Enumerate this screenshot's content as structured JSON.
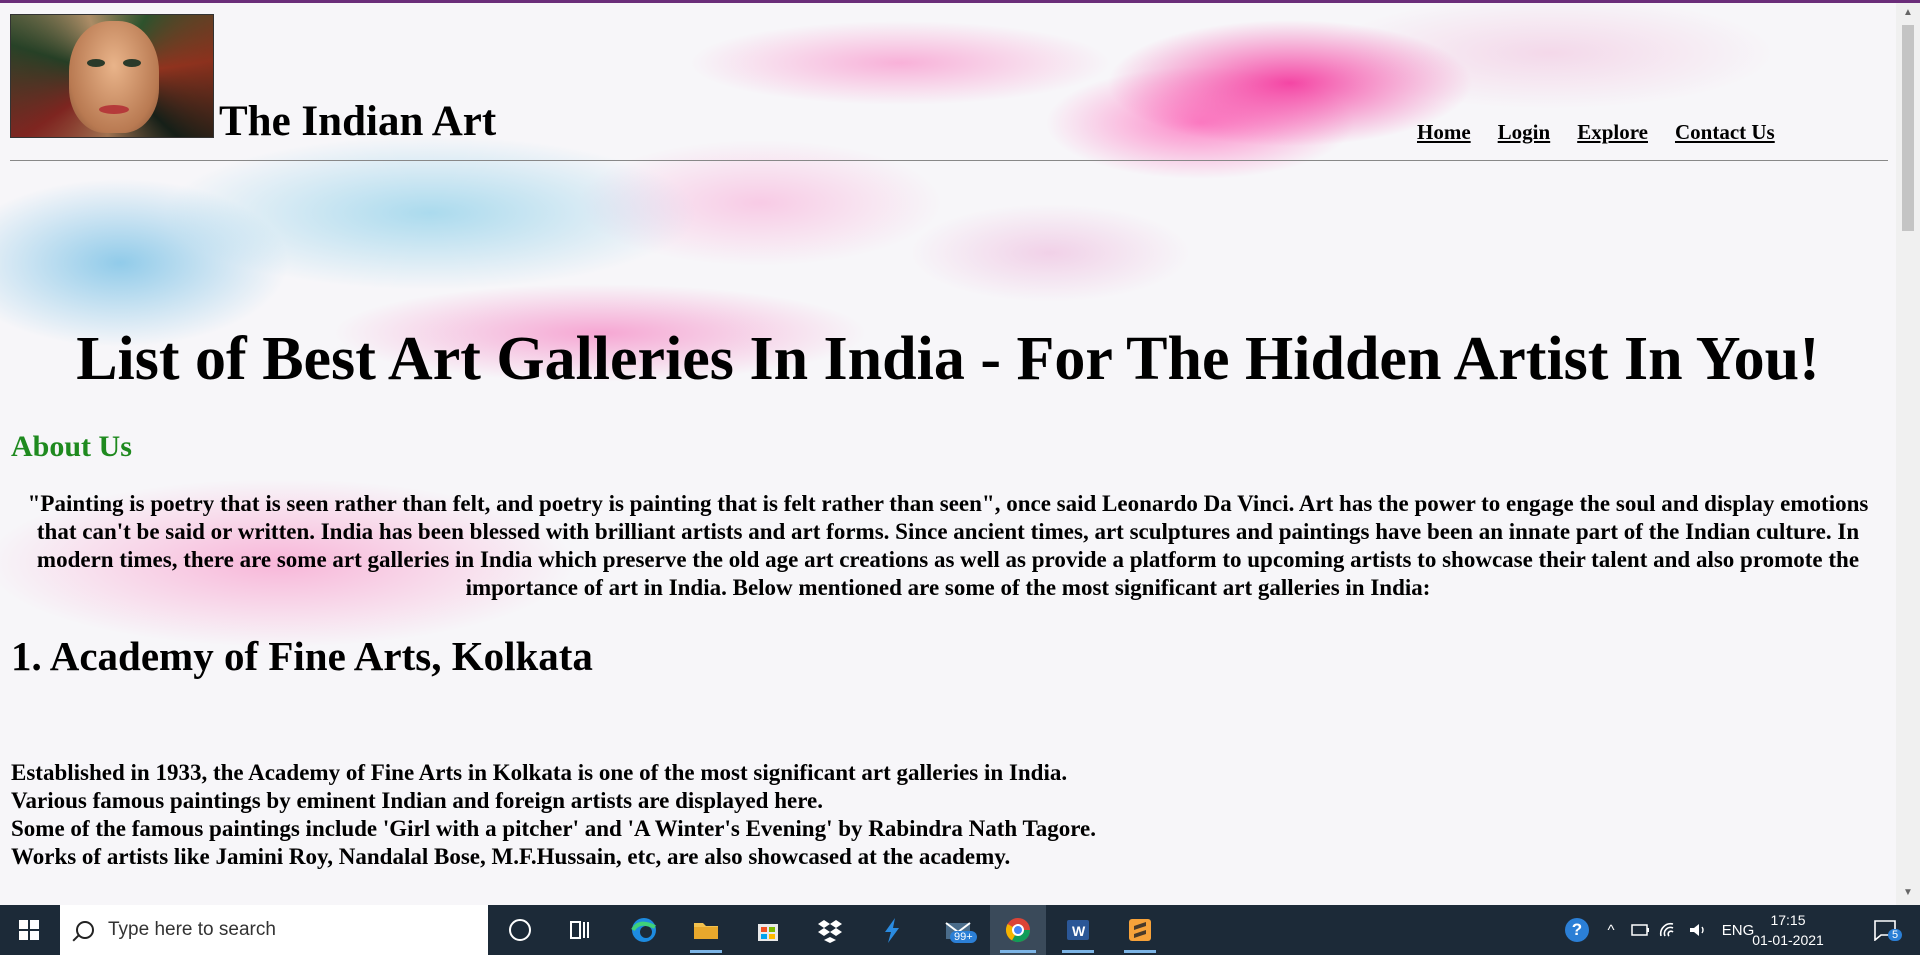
{
  "site": {
    "title": "The Indian Art",
    "nav": [
      "Home",
      "Login",
      "Explore",
      "Contact Us"
    ]
  },
  "main": {
    "headline": "List of Best Art Galleries In India - For The Hidden Artist In You!",
    "about_heading": "About Us",
    "intro": "\"Painting is poetry that is seen rather than felt, and poetry is painting that is felt rather than seen\", once said Leonardo Da Vinci. Art has the power to engage the soul and display emotions that can't be said or written. India has been blessed with brilliant artists and art forms. Since ancient times, art sculptures and paintings have been an innate part of the Indian culture. In modern times, there are some art galleries in India which preserve the old age art creations as well as provide a platform to upcoming artists to showcase their talent and also promote the importance of art in India. Below mentioned are some of the most significant art galleries in India:",
    "section1_title": "1. Academy of Fine Arts, Kolkata",
    "section1_lines": [
      "Established in 1933, the Academy of Fine Arts in Kolkata is one of the most significant art galleries in India.",
      "Various famous paintings by eminent Indian and foreign artists are displayed here.",
      "Some of the famous paintings include 'Girl with a pitcher' and 'A Winter's Evening' by Rabindra Nath Tagore.",
      "Works of artists like Jamini Roy, Nandalal Bose, M.F.Hussain, etc, are also showcased at the academy."
    ]
  },
  "taskbar": {
    "search_placeholder": "Type here to search",
    "mail_badge": "99+",
    "language": "ENG",
    "time": "17:15",
    "date": "01-01-2021",
    "notification_count": "5",
    "accent": "#1c2a38"
  }
}
